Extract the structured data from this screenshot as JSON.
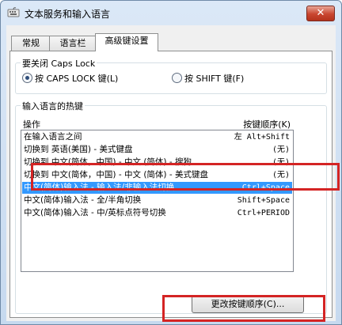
{
  "window": {
    "title": "文本服务和输入语言",
    "close_symbol": "✕"
  },
  "tabs": [
    {
      "label": "常规",
      "active": false
    },
    {
      "label": "语言栏",
      "active": false
    },
    {
      "label": "高级键设置",
      "active": true
    }
  ],
  "capslock": {
    "title": "要关闭 Caps Lock",
    "options": [
      {
        "label": "按 CAPS LOCK 键(L)",
        "selected": true
      },
      {
        "label": "按 SHIFT 键(F)",
        "selected": false
      }
    ]
  },
  "hotkeys": {
    "title": "输入语言的热键",
    "col_action": "操作",
    "col_key": "按键顺序(K)",
    "rows": [
      {
        "action": "在输入语言之间",
        "key": "左 Alt+Shift",
        "selected": false
      },
      {
        "action": "切换到 英语(美国) - 美式键盘",
        "key": "(无)",
        "selected": false
      },
      {
        "action": "切换到 中文(简体，中国) - 中文 (简体) - 搜狗...",
        "key": "(无)",
        "selected": false
      },
      {
        "action": "切换到 中文(简体，中国) - 中文 (简体) - 美式键盘",
        "key": "(无)",
        "selected": false
      },
      {
        "action": "中文(简体)输入法 - 输入法/非输入法切换",
        "key": "Ctrl+Space",
        "selected": true
      },
      {
        "action": "中文(简体)输入法 - 全/半角切换",
        "key": "Shift+Space",
        "selected": false
      },
      {
        "action": "中文(简体)输入法 - 中/英标点符号切换",
        "key": "Ctrl+PERIOD",
        "selected": false
      }
    ],
    "change_button": "更改按键顺序(C)..."
  },
  "colors": {
    "selection": "#3399ff",
    "highlight_box": "#d42424"
  }
}
